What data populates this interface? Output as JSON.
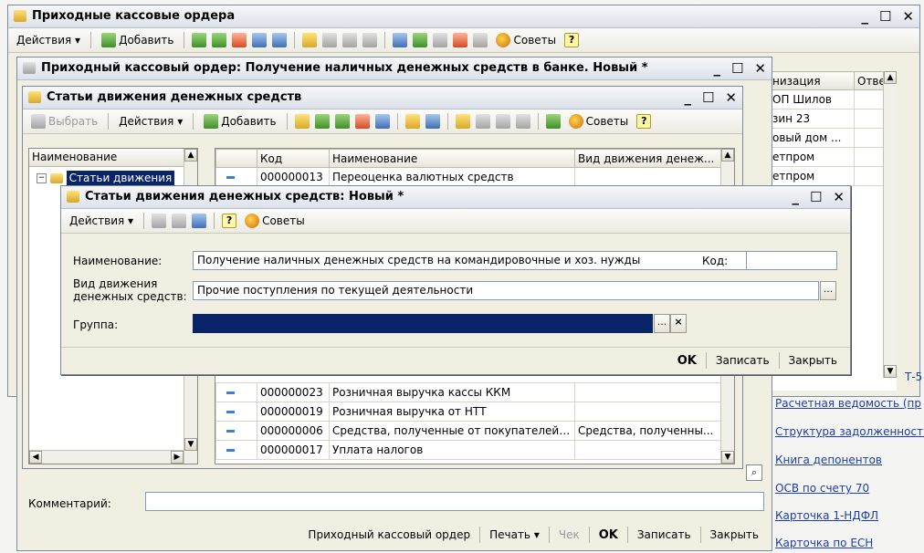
{
  "win1": {
    "title": "Приходные кассовые ордера",
    "toolbar": {
      "actions": "Действия ▾",
      "add": "Добавить",
      "tips": "Советы"
    },
    "right_headers": [
      "низация",
      "Отве"
    ],
    "right_rows": [
      "ОП  Шилов",
      "зин 23",
      "овый дом ...",
      "етпром",
      "етпром"
    ],
    "links": [
      "Расчетная ведомость (пр",
      "Структура задолженности",
      "Книга депонентов",
      "ОСВ по счету 70",
      "Карточка 1-НДФЛ",
      "Карточка по ЕСН"
    ],
    "t5": "Т-5"
  },
  "win2": {
    "title": "Приходный кассовый ордер: Получение наличных денежных средств в банке. Новый *",
    "comment_label": "Комментарий:",
    "comment_value": "",
    "buttons": {
      "pko": "Приходный кассовый ордер",
      "print": "Печать ▾",
      "check": "Чек",
      "ok": "OK",
      "save": "Записать",
      "close": "Закрыть"
    }
  },
  "win3": {
    "title": "Статьи движения денежных средств",
    "toolbar": {
      "select": "Выбрать",
      "actions": "Действия ▾",
      "add": "Добавить",
      "tips": "Советы"
    },
    "tree_header": "Наименование",
    "tree_root": "Статьи движения",
    "headers": {
      "code": "Код",
      "name": "Наименование",
      "kind": "Вид движения денеж..."
    },
    "rows_top": [
      {
        "code": "000000013",
        "name": "Переоценка валютных средств",
        "kind": ""
      }
    ],
    "rows_bottom": [
      {
        "code": "000000023",
        "name": "Розничная выручка кассы ККМ",
        "kind": ""
      },
      {
        "code": "000000019",
        "name": "Розничная выручка от НТТ",
        "kind": ""
      },
      {
        "code": "000000006",
        "name": "Средства, полученные от покупателей и ...",
        "kind": "Средства, полученны..."
      },
      {
        "code": "000000017",
        "name": "Уплата налогов",
        "kind": ""
      }
    ]
  },
  "win4": {
    "title": "Статьи движения денежных средств: Новый *",
    "toolbar": {
      "actions": "Действия ▾",
      "tips": "Советы"
    },
    "name_label": "Наименование:",
    "name_value": "Получение наличных денежных средств на командировочные и хоз. нужды",
    "code_label": "Код:",
    "code_value": "",
    "kind_label_1": "Вид движения",
    "kind_label_2": "денежных средств:",
    "kind_value": "Прочие поступления по текущей деятельности",
    "group_label": "Группа:",
    "group_value": "",
    "ellipsis": "...",
    "clear": "×",
    "buttons": {
      "ok": "OK",
      "save": "Записать",
      "close": "Закрыть"
    }
  }
}
